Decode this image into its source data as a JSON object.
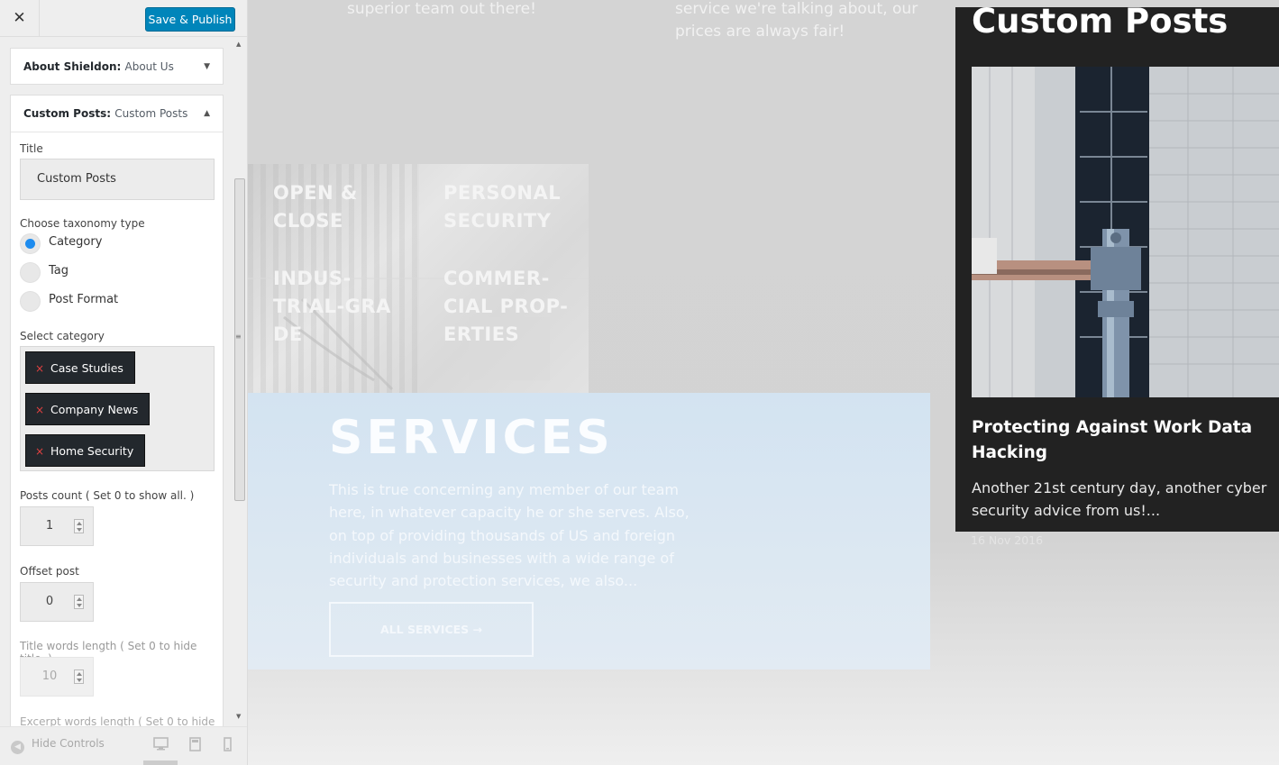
{
  "sidebar": {
    "close_glyph": "✕",
    "publish_label": "Save & Publish",
    "sections": {
      "about": {
        "bold": "About Shieldon:",
        "light": "About Us",
        "caret": "▼"
      },
      "custom": {
        "bold": "Custom Posts:",
        "light": "Custom Posts",
        "caret": "▲"
      }
    },
    "title_label": "Title",
    "title_value": "Custom Posts",
    "taxonomy_label": "Choose taxonomy type",
    "taxonomy_options": [
      "Category",
      "Tag",
      "Post Format"
    ],
    "taxonomy_selected": "Category",
    "select_category_label": "Select category",
    "categories": [
      "Case Studies",
      "Company News",
      "Home Security"
    ],
    "chip_remove": "×",
    "posts_count_label": "Posts count ( Set 0 to show all. )",
    "posts_count_value": "1",
    "offset_label": "Offset post",
    "offset_value": "0",
    "title_words_label": "Title words length ( Set 0 to hide title. )",
    "title_words_value": "10",
    "excerpt_words_label": "Excerpt words length ( Set 0 to hide",
    "hide_controls_label": "Hide Controls",
    "hide_controls_glyph": "◀",
    "devices": {
      "desktop_glyph": "🖥",
      "tablet_glyph": "▭",
      "mobile_glyph": "▯"
    }
  },
  "preview": {
    "hero_left": "superior team out there!",
    "hero_right": "service we're talking about, our prices are always fair!",
    "grid_items": [
      "OPEN & CLOSE",
      "PERSONAL SECURITY",
      "INDUS-TRIAL-GRA DE",
      "COMMER-CIAL PROP-ERTIES"
    ],
    "services": {
      "title": "SERVICES",
      "description": "This is true concerning any member of our team here, in whatever capacity he or she serves. Also, on top of providing thousands of US and foreign individuals and businesses with a wide range of security and protection services, we also...",
      "button": "ALL SERVICES →"
    },
    "widget": {
      "title": "Custom Posts",
      "post_title": "Protecting Against Work Data Hacking",
      "post_excerpt": "Another 21st century day, another cyber security advice from us!...",
      "post_date": "16 Nov 2016"
    }
  },
  "colors": {
    "publish": "#0085ba",
    "radio_on": "#1e8cef",
    "chip": "#23282d",
    "widget_bg": "#222222",
    "services_bg": "#d3e3f1"
  }
}
